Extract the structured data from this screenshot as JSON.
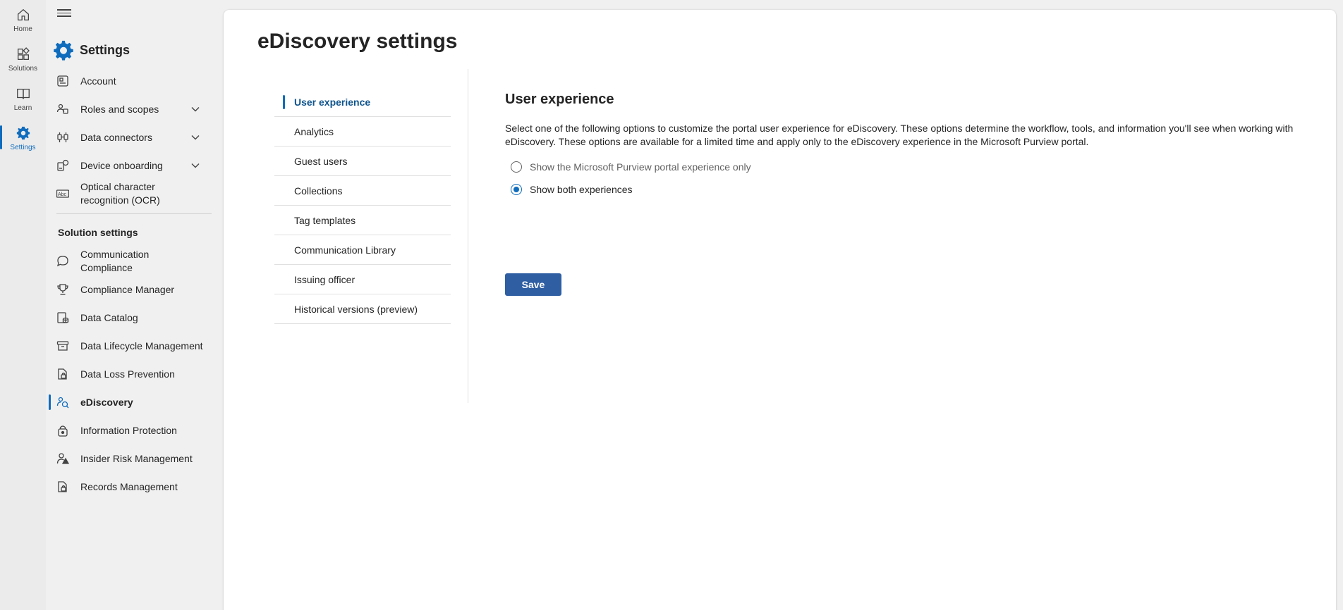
{
  "rail": [
    {
      "label": "Home",
      "icon": "home-icon"
    },
    {
      "label": "Solutions",
      "icon": "solutions-icon"
    },
    {
      "label": "Learn",
      "icon": "book-icon"
    },
    {
      "label": "Settings",
      "icon": "gear-icon"
    }
  ],
  "nav": {
    "title": "Settings",
    "items": [
      {
        "label": "Account",
        "icon": "account-icon"
      },
      {
        "label": "Roles and scopes",
        "icon": "roles-icon"
      },
      {
        "label": "Data connectors",
        "icon": "connector-icon"
      },
      {
        "label": "Device onboarding",
        "icon": "device-icon"
      },
      {
        "label": "Optical character recognition (OCR)",
        "icon": "ocr-icon"
      }
    ],
    "section_title": "Solution settings",
    "solutions": [
      {
        "label": "Communication Compliance",
        "icon": "chat-icon"
      },
      {
        "label": "Compliance Manager",
        "icon": "trophy-icon"
      },
      {
        "label": "Data Catalog",
        "icon": "catalog-icon"
      },
      {
        "label": "Data Lifecycle Management",
        "icon": "archive-icon"
      },
      {
        "label": "Data Loss Prevention",
        "icon": "dlp-icon"
      },
      {
        "label": "eDiscovery",
        "icon": "ediscovery-icon"
      },
      {
        "label": "Information Protection",
        "icon": "protection-icon"
      },
      {
        "label": "Insider Risk Management",
        "icon": "insider-risk-icon"
      },
      {
        "label": "Records Management",
        "icon": "records-icon"
      }
    ]
  },
  "main": {
    "title": "eDiscovery settings",
    "subnav": [
      "User experience",
      "Analytics",
      "Guest users",
      "Collections",
      "Tag templates",
      "Communication Library",
      "Issuing officer",
      "Historical versions (preview)"
    ],
    "section_heading": "User experience",
    "description": "Select one of the following options to customize the portal user experience for eDiscovery. These options determine the workflow, tools, and information you'll see when working with eDiscovery. These options are available for a limited time and apply only to the eDiscovery experience in the Microsoft Purview portal.",
    "options": [
      {
        "label": "Show the Microsoft Purview portal experience only",
        "checked": false
      },
      {
        "label": "Show both experiences",
        "checked": true
      }
    ],
    "save_label": "Save"
  },
  "colors": {
    "accent": "#0f6cbd",
    "save_button": "#2f5ea3"
  }
}
